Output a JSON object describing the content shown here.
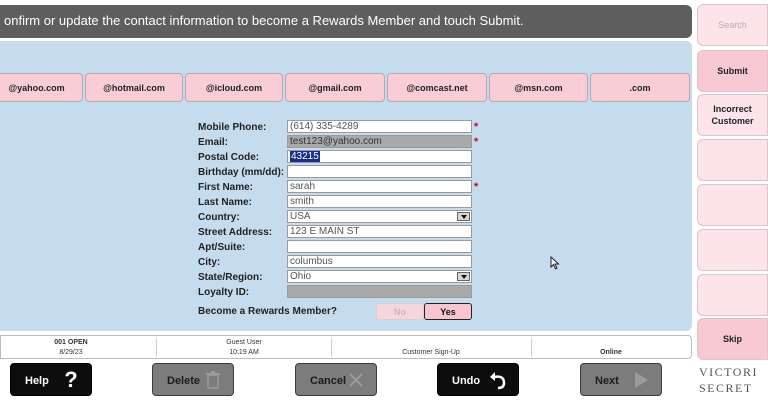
{
  "header": {
    "instruction": "onfirm or update the contact information to become a Rewards Member and touch Submit."
  },
  "domains": [
    "@yahoo.com",
    "@hotmail.com",
    "@icloud.com",
    "@gmail.com",
    "@comcast.net",
    "@msn.com",
    ".com"
  ],
  "form": {
    "mobile_phone": {
      "label": "Mobile Phone:",
      "value": "(614) 335-4289",
      "required": "*"
    },
    "email": {
      "label": "Email:",
      "value": "test123@yahoo.com",
      "required": "*"
    },
    "postal_code": {
      "label": "Postal Code:",
      "value": "43215"
    },
    "birthday": {
      "label": "Birthday (mm/dd):",
      "value": ""
    },
    "first_name": {
      "label": "First Name:",
      "value": "sarah",
      "required": "*"
    },
    "last_name": {
      "label": "Last Name:",
      "value": "smith"
    },
    "country": {
      "label": "Country:",
      "value": "USA"
    },
    "street_address": {
      "label": "Street Address:",
      "value": "123 E MAIN ST"
    },
    "apt_suite": {
      "label": "Apt/Suite:",
      "value": ""
    },
    "city": {
      "label": "City:",
      "value": "columbus"
    },
    "state_region": {
      "label": "State/Region:",
      "value": "Ohio"
    },
    "loyalty_id": {
      "label": "Loyalty ID:",
      "value": ""
    },
    "member_question": "Become a Rewards Member?",
    "no_label": "No",
    "yes_label": "Yes"
  },
  "status_bar": {
    "register": "001 OPEN",
    "date": "8/29/23",
    "user": "Guest User",
    "time": "10:19 AM",
    "screen": "Customer Sign-Up",
    "connection": "Online"
  },
  "bottom_buttons": {
    "help": "Help",
    "delete": "Delete",
    "cancel": "Cancel",
    "undo": "Undo",
    "next": "Next"
  },
  "side_buttons": {
    "search": "Search",
    "submit": "Submit",
    "incorrect_customer": "Incorrect\nCustomer",
    "skip": "Skip"
  },
  "logo": {
    "line1": "VICTORI",
    "line2": "SECRET"
  },
  "colors": {
    "panel": "#c5dbee",
    "accent_pink": "#f9cdd6",
    "banner": "#5e5e5e",
    "required": "#d0021b"
  }
}
